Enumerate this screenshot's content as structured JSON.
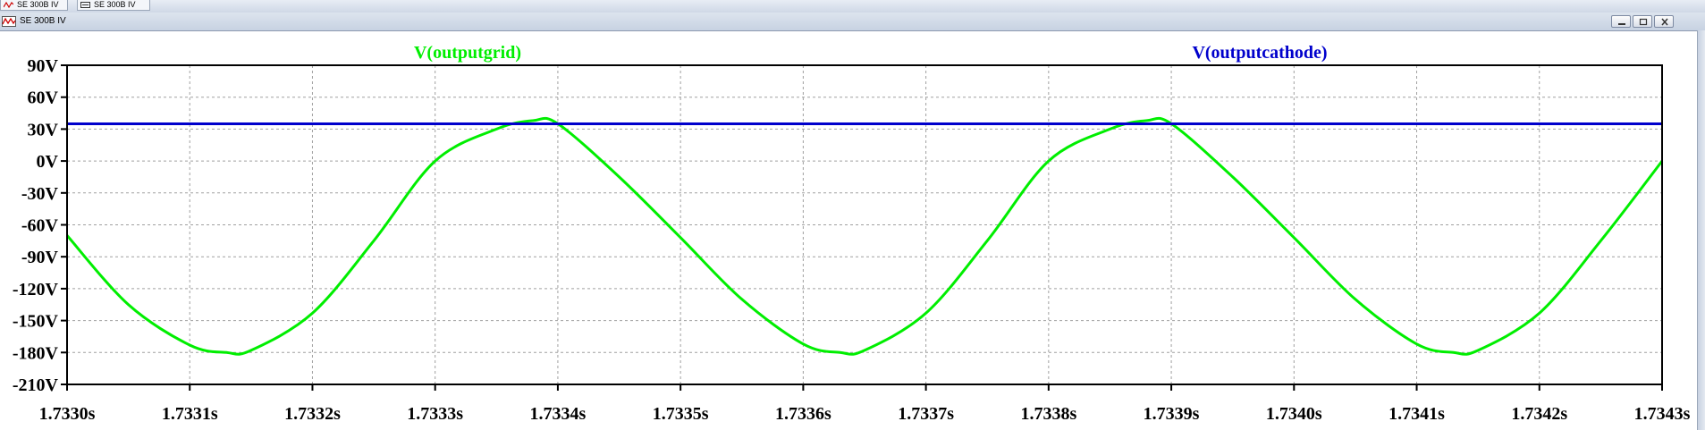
{
  "tabs": [
    {
      "label": "SE 300B IV"
    },
    {
      "label": "SE 300B IV"
    }
  ],
  "window": {
    "title": "SE 300B IV"
  },
  "colors": {
    "grid_trace": "#00ee00",
    "cathode_trace": "#0000cc",
    "axis": "#000000",
    "grid": "#a0a0a0"
  },
  "chart_data": {
    "type": "line",
    "xlim": [
      1.733,
      1.7343
    ],
    "ylim": [
      -210,
      90
    ],
    "x_ticks": [
      "1.7330s",
      "1.7331s",
      "1.7332s",
      "1.7333s",
      "1.7334s",
      "1.7335s",
      "1.7336s",
      "1.7337s",
      "1.7338s",
      "1.7339s",
      "1.7340s",
      "1.7341s",
      "1.7342s",
      "1.7343s"
    ],
    "y_ticks": [
      "90V",
      "60V",
      "30V",
      "0V",
      "-30V",
      "-60V",
      "-90V",
      "-120V",
      "-150V",
      "-180V",
      "-210V"
    ],
    "grid": true,
    "series": [
      {
        "name": "V(outputgrid)",
        "color": "#00ee00",
        "x": [
          1.733,
          1.73305,
          1.7331,
          1.73313,
          1.73315,
          1.7332,
          1.73325,
          1.7333,
          1.73335,
          1.73338,
          1.7334,
          1.73345,
          1.7335,
          1.73355,
          1.7336,
          1.73363,
          1.73365,
          1.7337,
          1.73375,
          1.7338,
          1.73385,
          1.73388,
          1.7339,
          1.73395,
          1.734,
          1.73405,
          1.7341,
          1.73413,
          1.73415,
          1.7342,
          1.73425,
          1.7343
        ],
        "y": [
          -70,
          -135,
          -173,
          -180,
          -178,
          -143,
          -75,
          0,
          30,
          38,
          35,
          -15,
          -72,
          -130,
          -172,
          -180,
          -178,
          -143,
          -75,
          0,
          30,
          38,
          35,
          -15,
          -72,
          -130,
          -172,
          -180,
          -178,
          -143,
          -75,
          0
        ]
      },
      {
        "name": "V(outputcathode)",
        "color": "#0000cc",
        "x": [
          1.733,
          1.7343
        ],
        "y": [
          35,
          35
        ]
      }
    ]
  }
}
